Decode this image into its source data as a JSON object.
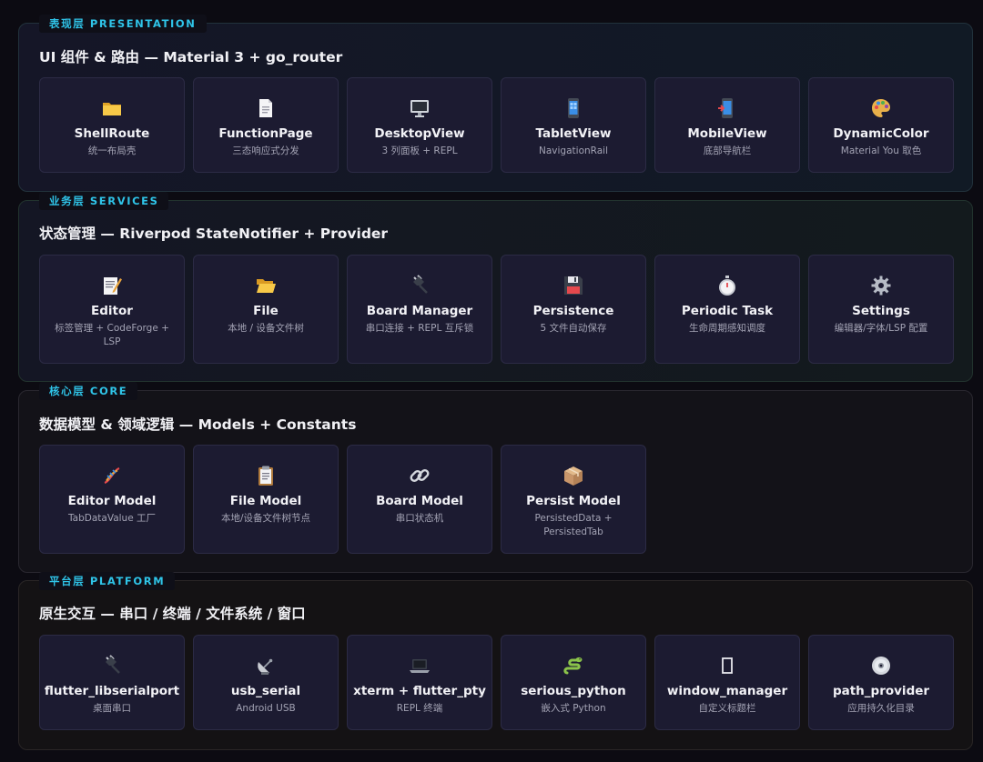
{
  "layers": [
    {
      "tag": "表现层 PRESENTATION",
      "title": "UI 组件 & 路由 — Material 3 + go_router",
      "cards": [
        {
          "icon": "folder-icon",
          "title": "ShellRoute",
          "subtitle": "统一布局壳"
        },
        {
          "icon": "page-icon",
          "title": "FunctionPage",
          "subtitle": "三态响应式分发"
        },
        {
          "icon": "desktop-icon",
          "title": "DesktopView",
          "subtitle": "3 列面板 + REPL"
        },
        {
          "icon": "tablet-icon",
          "title": "TabletView",
          "subtitle": "NavigationRail"
        },
        {
          "icon": "mobile-icon",
          "title": "MobileView",
          "subtitle": "底部导航栏"
        },
        {
          "icon": "palette-icon",
          "title": "DynamicColor",
          "subtitle": "Material You 取色"
        }
      ]
    },
    {
      "tag": "业务层 SERVICES",
      "title": "状态管理 — Riverpod StateNotifier + Provider",
      "cards": [
        {
          "icon": "memo-icon",
          "title": "Editor",
          "subtitle": "标签管理 + CodeForge + LSP"
        },
        {
          "icon": "open-folder-icon",
          "title": "File",
          "subtitle": "本地 / 设备文件树"
        },
        {
          "icon": "plug-icon",
          "title": "Board Manager",
          "subtitle": "串口连接 + REPL 互斥锁"
        },
        {
          "icon": "floppy-disk-icon",
          "title": "Persistence",
          "subtitle": "5 文件自动保存"
        },
        {
          "icon": "stopwatch-icon",
          "title": "Periodic Task",
          "subtitle": "生命周期感知调度"
        },
        {
          "icon": "gear-icon",
          "title": "Settings",
          "subtitle": "编辑器/字体/LSP 配置"
        }
      ]
    },
    {
      "tag": "核心层 CORE",
      "title": "数据模型 & 领域逻辑 — Models + Constants",
      "cards": [
        {
          "icon": "dna-icon",
          "title": "Editor Model",
          "subtitle": "TabDataValue 工厂"
        },
        {
          "icon": "clipboard-icon",
          "title": "File Model",
          "subtitle": "本地/设备文件树节点"
        },
        {
          "icon": "chain-link-icon",
          "title": "Board Model",
          "subtitle": "串口状态机"
        },
        {
          "icon": "package-icon",
          "title": "Persist Model",
          "subtitle": "PersistedData + PersistedTab"
        }
      ]
    },
    {
      "tag": "平台层 PLATFORM",
      "title": "原生交互 — 串口 / 终端 / 文件系统 / 窗口",
      "cards": [
        {
          "icon": "plug-icon",
          "title": "flutter_libserialport",
          "subtitle": "桌面串口"
        },
        {
          "icon": "satellite-dish-icon",
          "title": "usb_serial",
          "subtitle": "Android USB"
        },
        {
          "icon": "laptop-icon",
          "title": "xterm + flutter_pty",
          "subtitle": "REPL 终端"
        },
        {
          "icon": "snake-icon",
          "title": "serious_python",
          "subtitle": "嵌入式 Python"
        },
        {
          "icon": "window-icon",
          "title": "window_manager",
          "subtitle": "自定义标题栏"
        },
        {
          "icon": "disc-icon",
          "title": "path_provider",
          "subtitle": "应用持久化目录"
        }
      ]
    }
  ]
}
